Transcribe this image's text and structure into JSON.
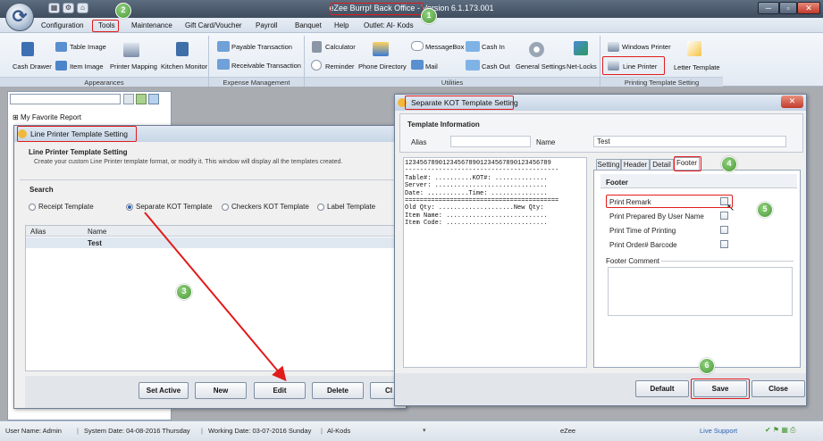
{
  "window": {
    "title": "eZee Burrp! Back Office - Version 6.1.173.001",
    "controls": [
      "─",
      "▫",
      "✕"
    ]
  },
  "menu": [
    "Configuration",
    "Tools",
    "Maintenance",
    "Gift Card/Voucher",
    "Payroll",
    "Banquet",
    "Help",
    "Outlet: Al- Kods"
  ],
  "ribbon": {
    "appearances": {
      "items": [
        "Table Image",
        "Cash Drawer",
        "Item Image",
        "Printer Mapping",
        "Kitchen Monitor"
      ],
      "label": "Appearances"
    },
    "expense": {
      "items": [
        "Payable Transaction",
        "Receivable Transaction"
      ],
      "label": "Expense Management"
    },
    "utilities": {
      "items": [
        "Calculator",
        "Reminder",
        "Phone Directory",
        "MessageBox",
        "Mail",
        "Cash In",
        "Cash Out",
        "General Settings",
        "Net-Locks"
      ],
      "label": "Utilities"
    },
    "printing": {
      "items": [
        "Windows Printer",
        "Line Printer",
        "Letter Template"
      ],
      "label": "Printing Template Setting"
    }
  },
  "tree": {
    "item": "My Favorite Report"
  },
  "line_printer": {
    "title": "Line Printer Template Setting",
    "heading": "Line Printer Template Setting",
    "subheading": "Create your custom Line Printer template format, or modify it. This window will display all the templates created.",
    "search_label": "Search",
    "options": [
      "Receipt Template",
      "Separate KOT Template",
      "Checkers KOT Template",
      "Label Template"
    ],
    "columns": [
      "Alias",
      "Name"
    ],
    "rows": [
      {
        "alias": "",
        "name": "Test"
      }
    ],
    "buttons": [
      "Set Active",
      "New",
      "Edit",
      "Delete",
      "Cl"
    ]
  },
  "kot": {
    "title": "Separate KOT Template Setting",
    "section": "Template Information",
    "alias_label": "Alias",
    "alias_value": "",
    "name_label": "Name",
    "name_value": "Test",
    "preview": "123456789012345678901234567890123456789\n-----------------------------------------\nTable#: ..........KOT#: ..............\nServer: ..............................\nDate: ...........Time: ...............\n=========================================\nOld Qty: ....................New Qty:\nItem Name: ...........................\nItem Code: ...........................",
    "tabs": [
      "Setting",
      "Header",
      "Detail",
      "Footer"
    ],
    "footer_heading": "Footer",
    "checks": [
      {
        "label": "Print Remark",
        "checked": false
      },
      {
        "label": "Print Prepared By User Name",
        "checked": false
      },
      {
        "label": "Print Time of Printing",
        "checked": false
      },
      {
        "label": "Print Order# Barcode",
        "checked": false
      }
    ],
    "comment_label": "Footer Comment",
    "buttons": [
      "Default",
      "Save",
      "Close"
    ]
  },
  "steps": [
    "1",
    "2",
    "3",
    "4",
    "5",
    "6"
  ],
  "status": {
    "user": "User Name:  Admin",
    "system_date": "System Date:  04-08-2016 Thursday",
    "working_date": "Working Date:  03-07-2016 Sunday",
    "outlet": "Al-Kods",
    "app": "eZee",
    "live_support": "Live Support"
  },
  "colors": {
    "highlight": "#e21b1b",
    "badge": "#4c9a3a",
    "titlebar": "#4a596b"
  }
}
